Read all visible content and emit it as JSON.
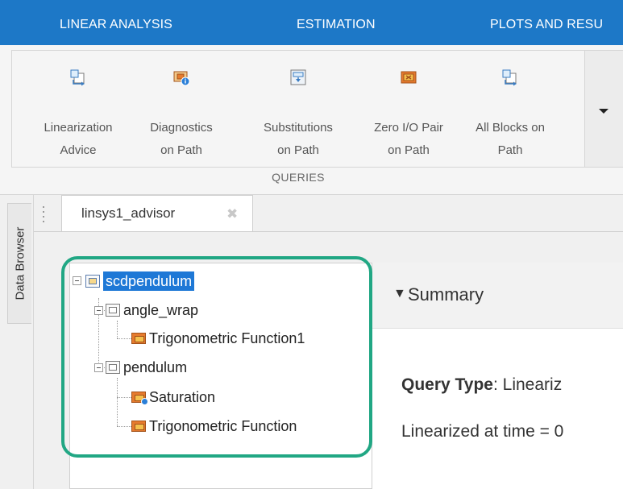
{
  "ribbon": {
    "tabs": [
      "LINEAR ANALYSIS",
      "ESTIMATION",
      "PLOTS AND RESU"
    ]
  },
  "toolstrip": {
    "queries": [
      {
        "label": "Linearization\nAdvice",
        "icon": "linearization-advice-icon"
      },
      {
        "label": "Diagnostics\non Path",
        "icon": "diagnostics-icon"
      },
      {
        "label": "Substitutions\non Path",
        "icon": "substitutions-icon"
      },
      {
        "label": "Zero I/O Pair\non Path",
        "icon": "zero-io-pair-icon"
      },
      {
        "label": "All Blocks on\nPath",
        "icon": "all-blocks-icon"
      }
    ],
    "section_label": "QUERIES",
    "more_icon": "dropdown-arrow-icon"
  },
  "side_panel": {
    "label": "Data Browser"
  },
  "document": {
    "tab_label": "linsys1_advisor",
    "close_glyph": "✖"
  },
  "tree": {
    "root": "scdpendulum",
    "children": [
      {
        "label": "angle_wrap",
        "children": [
          "Trigonometric Function1"
        ]
      },
      {
        "label": "pendulum",
        "children": [
          "Saturation",
          "Trigonometric Function"
        ]
      }
    ]
  },
  "summary": {
    "collapse_glyph": "▼",
    "title": "Summary",
    "query_type_label": "Query Type",
    "query_type_value": ": Lineariz",
    "linearized_text": "Linearized at time = 0"
  },
  "colors": {
    "ribbon_blue": "#1d78c7",
    "highlight_green": "#21a784",
    "selection_blue": "#1e78d6",
    "block_orange": "#e67b2e"
  }
}
